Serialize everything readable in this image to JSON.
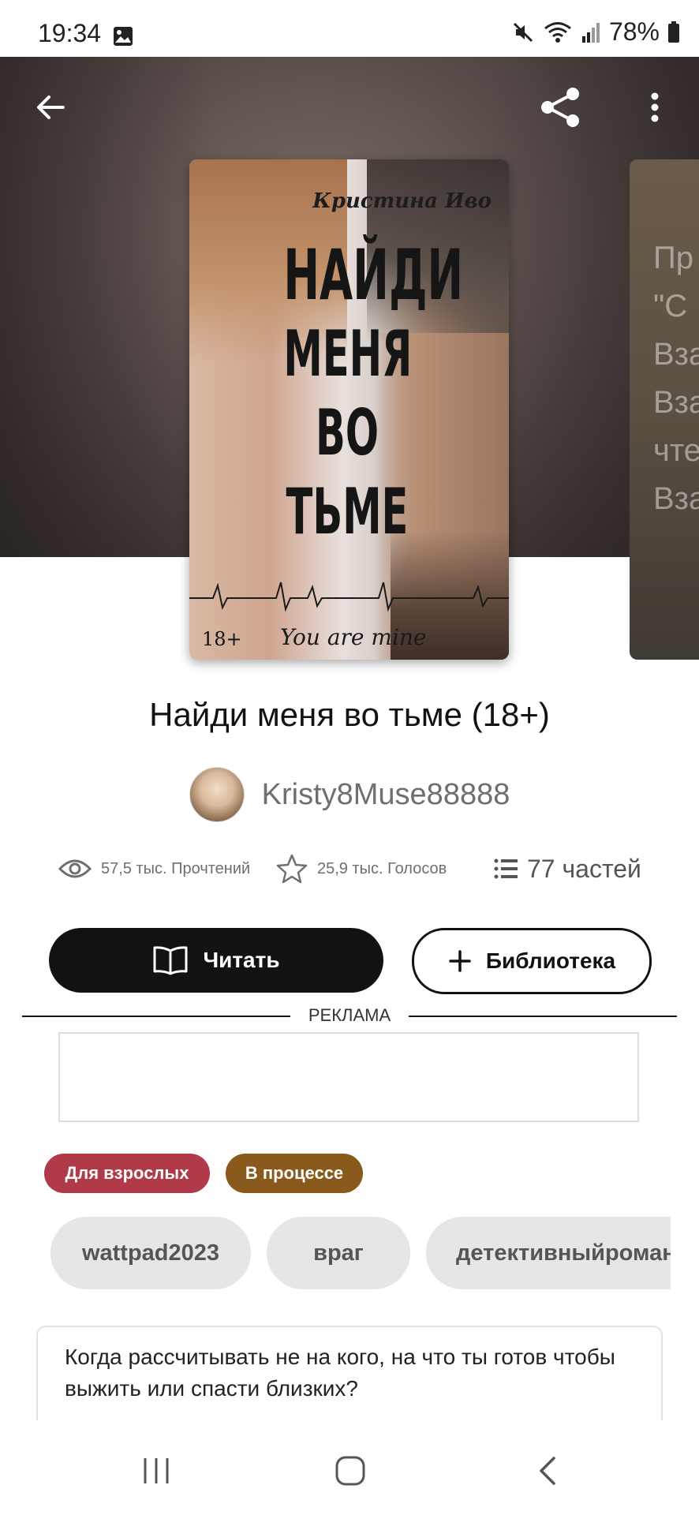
{
  "status_bar": {
    "time": "19:34",
    "battery": "78%"
  },
  "header": {
    "back_icon": "arrow-left-icon",
    "share_icon": "share-icon",
    "more_icon": "more-vertical-icon"
  },
  "cover": {
    "author_text": "Кристина Иво",
    "title_lines": [
      "НАЙДИ",
      "МЕНЯ",
      "ВО",
      "ТЬМЕ"
    ],
    "age": "18+",
    "tagline": "You are mine"
  },
  "peek_card": {
    "lines": [
      "Пр",
      "\"С",
      "Вза",
      "Вза",
      "чте",
      "Вза"
    ]
  },
  "book": {
    "title": "Найди меня во тьме (18+)",
    "author": "Kristy8Muse88888",
    "reads": "57,5 тыс. Прочтений",
    "votes": "25,9 тыс. Голосов",
    "parts": "77 частей"
  },
  "actions": {
    "read_label": "Читать",
    "library_label": "Библиотека"
  },
  "ad": {
    "label": "РЕКЛАМА"
  },
  "badges": {
    "mature": "Для взрослых",
    "ongoing": "В процессе"
  },
  "tags": [
    "wattpad2023",
    "враг",
    "детективныйроман"
  ],
  "description": "Когда рассчитывать не на кого, на что ты готов чтобы выжить или спасти близких?",
  "colors": {
    "mature_badge": "#b03a48",
    "ongoing_badge": "#8a5a1c",
    "primary": "#121212",
    "tag_bg": "#e6e5e8"
  }
}
